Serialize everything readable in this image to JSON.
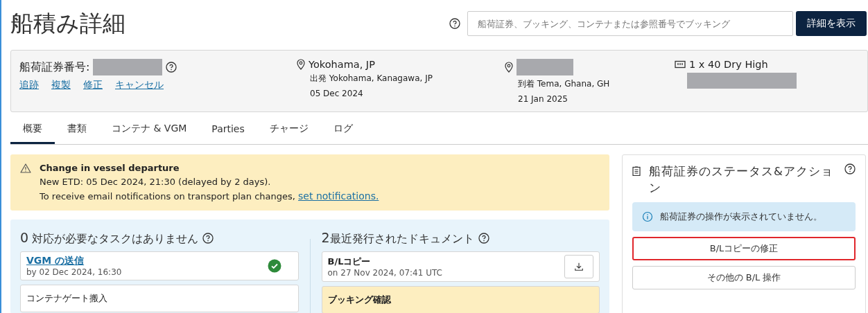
{
  "page_title": "船積み詳細",
  "search": {
    "placeholder": "船荷証券、ブッキング、コンテナまたは参照番号でブッキング",
    "button": "詳細を表示"
  },
  "header": {
    "bl_label": "船荷証券番号:",
    "links": [
      "追跡",
      "複製",
      "修正",
      "キャンセル"
    ],
    "origin": {
      "place": "Yokohama, JP",
      "detail": "出発 Yokohama, Kanagawa, JP",
      "date": "05 Dec 2024"
    },
    "destination": {
      "detail": "到着 Tema, Ghana, GH",
      "date": "21 Jan 2025"
    },
    "equipment": {
      "text": "1 x 40 Dry High"
    }
  },
  "tabs": [
    {
      "label": "概要",
      "selected": true
    },
    {
      "label": "書類",
      "selected": false
    },
    {
      "label": "コンテナ & VGM",
      "selected": false
    },
    {
      "label": "Parties",
      "selected": false
    },
    {
      "label": "チャージ",
      "selected": false
    },
    {
      "label": "ログ",
      "selected": false
    }
  ],
  "alert": {
    "title": "Change in vessel departure",
    "line1": "New ETD: 05 Dec 2024, 21:30 (delayed by 2 days).",
    "line2": "To receive email notifications on transport plan changes,",
    "link": "set notifications."
  },
  "tasks": {
    "count": "0",
    "title": "対応が必要なタスクはありません",
    "items": [
      {
        "title": "VGM の送信",
        "subtitle": "by 02 Dec 2024, 16:30",
        "done": true,
        "link": true
      },
      {
        "title": "コンテナゲート搬入",
        "done": false,
        "link": false
      }
    ]
  },
  "documents": {
    "count": "2",
    "title": "最近発行されたドキュメント",
    "items": [
      {
        "title": "B/Lコピー",
        "subtitle": "on 27 Nov 2024, 07:41 UTC",
        "kind": "download"
      },
      {
        "title": "ブッキング確認",
        "kind": "highlight"
      }
    ]
  },
  "status_panel": {
    "title": "船荷証券のステータス&アクション",
    "info": "船荷証券の操作が表示されていません。",
    "buttons": [
      {
        "label": "B/Lコピーの修正",
        "highlighted": true
      },
      {
        "label": "その他の B/L 操作",
        "highlighted": false
      }
    ]
  }
}
